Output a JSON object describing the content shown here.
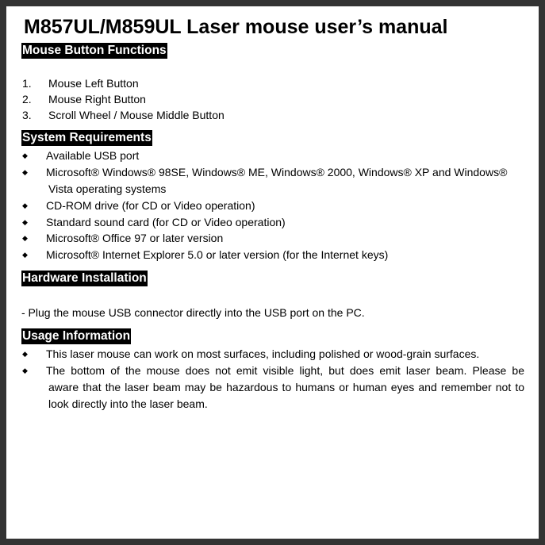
{
  "document": {
    "title": "M857UL/M859UL Laser mouse user’s manual",
    "sections": {
      "button_functions": {
        "heading": "Mouse Button Functions",
        "items": [
          {
            "number": "1.",
            "text": "Mouse Left Button"
          },
          {
            "number": "2.",
            "text": "Mouse Right Button"
          },
          {
            "number": "3.",
            "text": "Scroll Wheel / Mouse Middle Button"
          }
        ]
      },
      "system_requirements": {
        "heading": "System Requirements",
        "bullet_icon": "diamond-bullet",
        "bullet_glyph": "◆",
        "items": [
          {
            "lines": [
              "Available USB port"
            ]
          },
          {
            "lines": [
              "Microsoft® Windows® 98SE, Windows® ME, Windows® 2000, Windows® XP and Windows®",
              "Vista operating systems"
            ]
          },
          {
            "lines": [
              "CD-ROM drive (for CD or Video operation)"
            ]
          },
          {
            "lines": [
              "Standard sound card (for CD or Video operation)"
            ]
          },
          {
            "lines": [
              "Microsoft® Office 97 or later version"
            ]
          },
          {
            "lines": [
              "Microsoft® Internet Explorer 5.0 or later version (for the Internet keys)"
            ]
          }
        ]
      },
      "hardware_installation": {
        "heading": "Hardware Installation",
        "text": "- Plug the mouse USB connector directly into the USB port on the PC."
      },
      "usage_information": {
        "heading": "Usage Information",
        "items": [
          {
            "lines": [
              "This laser mouse can work on most surfaces, including polished or wood-grain surfaces."
            ]
          },
          {
            "lines": [
              "The bottom of the mouse does not emit visible light, but does emit laser beam. Please be",
              "aware that the laser beam may be hazardous to humans or human eyes and remember not to",
              "look directly into the laser beam."
            ]
          }
        ]
      }
    }
  }
}
